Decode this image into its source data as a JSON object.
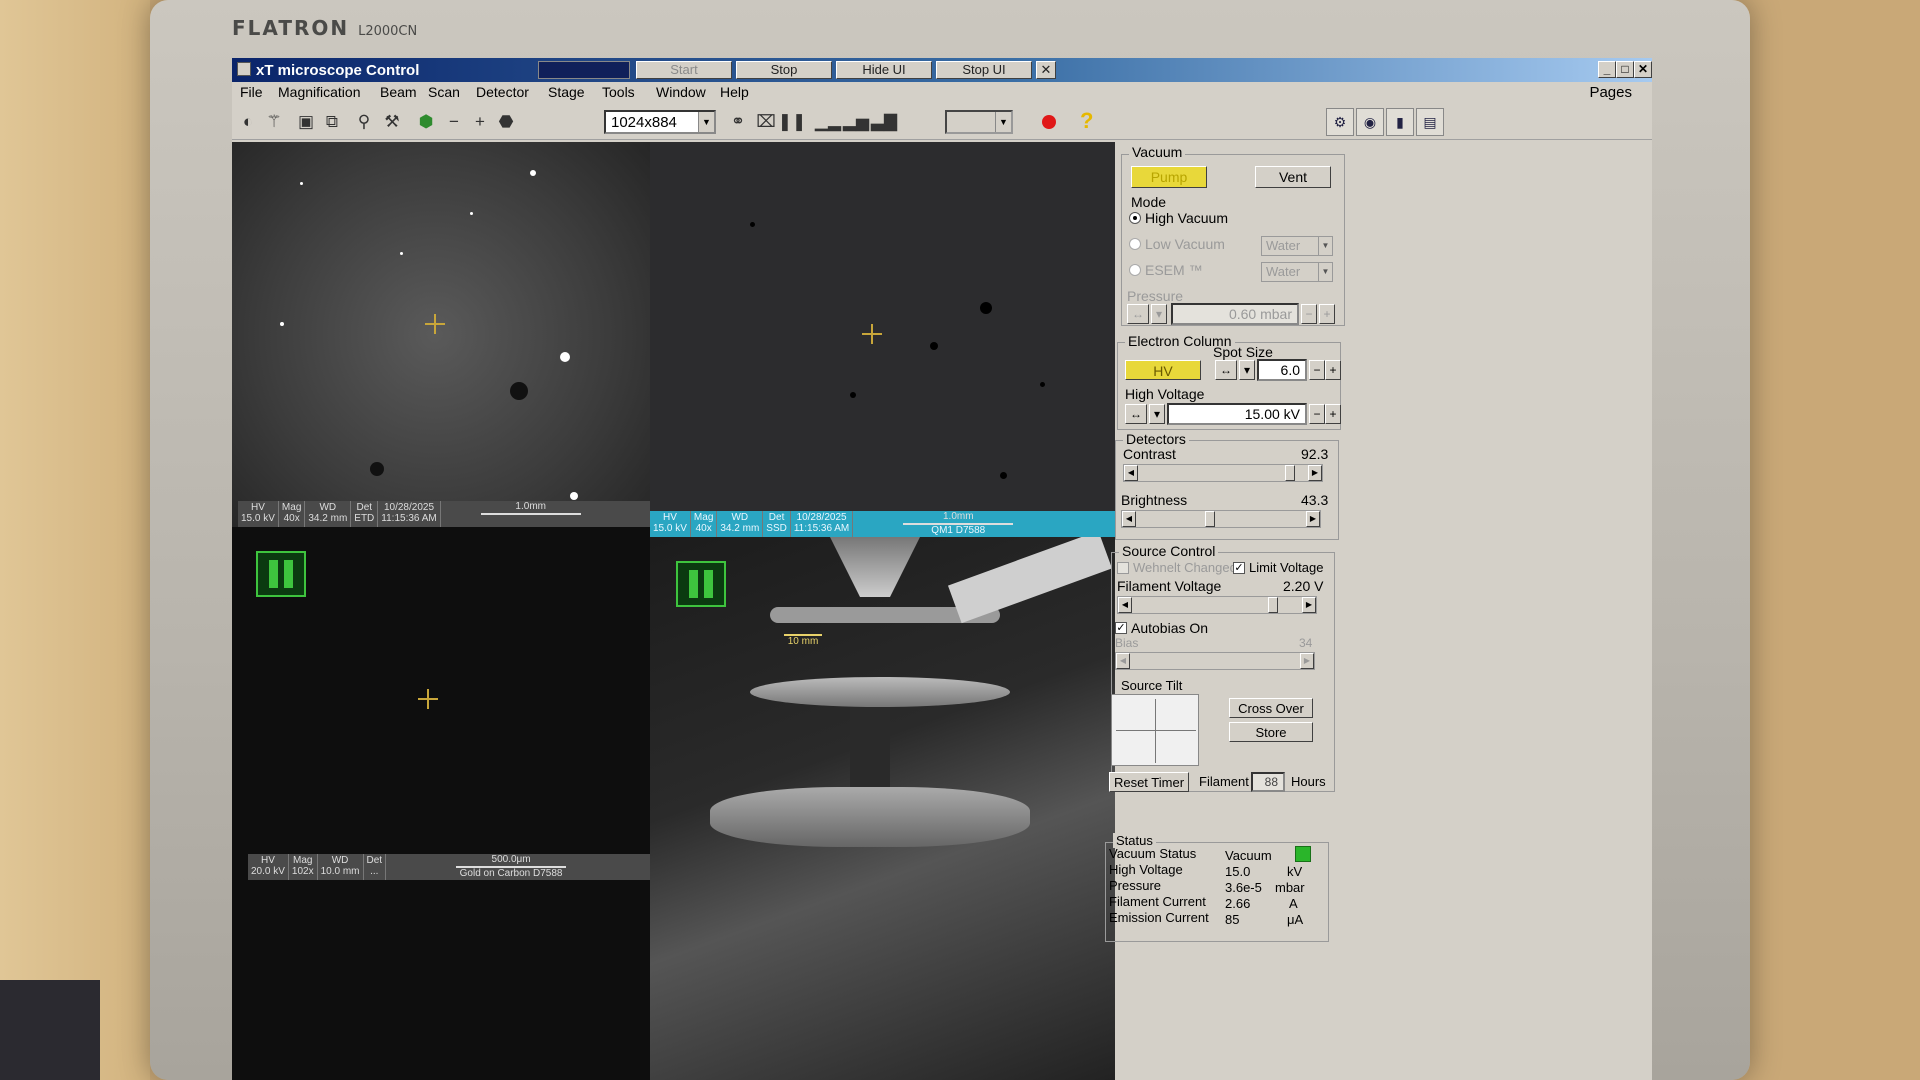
{
  "monitor": {
    "brand": "FLATRON",
    "model": "L2000CN"
  },
  "window": {
    "title": "xT microscope Control",
    "buttons": {
      "start": "Start",
      "stop": "Stop",
      "hide_ui": "Hide UI",
      "stop_ui": "Stop UI",
      "close": "✕"
    },
    "controls": {
      "minimize": "_",
      "maximize": "□",
      "close": "✕"
    }
  },
  "menu": {
    "items": [
      "File",
      "Magnification",
      "Beam",
      "Scan",
      "Detector",
      "Stage",
      "Tools",
      "Window",
      "Help"
    ],
    "pages": "Pages"
  },
  "toolbar": {
    "resolution": "1024x884",
    "icons": [
      "beam-icon",
      "detector-icon",
      "image-icon",
      "frame-icon",
      "focus-icon",
      "stage-icon",
      "turtle-slow-icon",
      "zoom-out-icon",
      "zoom-in-icon",
      "turtle-fast-icon",
      "link-icon",
      "camera-icon",
      "pause-icon",
      "histogram-1-icon",
      "histogram-2-icon",
      "histogram-3-icon",
      "record-icon",
      "help-icon"
    ],
    "help": "?"
  },
  "quads": {
    "q1": {
      "databar": [
        {
          "label": "HV",
          "value": "15.0 kV"
        },
        {
          "label": "Mag",
          "value": "40x"
        },
        {
          "label": "WD",
          "value": "34.2 mm"
        },
        {
          "label": "Det",
          "value": "ETD"
        },
        {
          "label": "10/28/2025",
          "value": "11:15:36 AM"
        }
      ],
      "scale": "1.0mm"
    },
    "q2": {
      "databar": [
        {
          "label": "HV",
          "value": "15.0 kV"
        },
        {
          "label": "Mag",
          "value": "40x"
        },
        {
          "label": "WD",
          "value": "34.2 mm"
        },
        {
          "label": "Det",
          "value": "SSD"
        },
        {
          "label": "10/28/2025",
          "value": "11:15:36 AM"
        }
      ],
      "scale": "1.0mm",
      "label": "QM1 D7588"
    },
    "q3": {
      "databar": [
        {
          "label": "HV",
          "value": "20.0 kV"
        },
        {
          "label": "Mag",
          "value": "102x"
        },
        {
          "label": "WD",
          "value": "10.0 mm"
        },
        {
          "label": "Det",
          "value": "..."
        }
      ],
      "scale": "500.0μm",
      "label": "Gold on Carbon D7588"
    },
    "q4": {
      "scale": "10 mm"
    }
  },
  "panel": {
    "vacuum": {
      "title": "Vacuum",
      "pump": "Pump",
      "vent": "Vent",
      "mode_title": "Mode",
      "high_vacuum": "High Vacuum",
      "low_vacuum": "Low Vacuum",
      "esem": "ESEM ™",
      "water1": "Water",
      "water2": "Water",
      "pressure_label": "Pressure",
      "pressure_value": "0.60",
      "pressure_unit": "mbar"
    },
    "electron_column": {
      "title": "Electron Column",
      "hv": "HV",
      "spot_label": "Spot Size",
      "spot_value": "6.0",
      "hv_label": "High Voltage",
      "hv_value": "15.00 kV"
    },
    "detectors": {
      "title": "Detectors",
      "contrast_label": "Contrast",
      "contrast_value": "92.3",
      "contrast_fraction": 0.92,
      "brightness_label": "Brightness",
      "brightness_value": "43.3",
      "brightness_fraction": 0.43
    },
    "source": {
      "title": "Source Control",
      "wehnelt": "Wehnelt Changed",
      "limit_voltage": "Limit Voltage",
      "filament_label": "Filament Voltage",
      "filament_value": "2.20 V",
      "filament_fraction": 0.85,
      "autobias": "Autobias On",
      "bias_label": "Bias",
      "bias_value": "34",
      "tilt_label": "Source Tilt",
      "cross_over": "Cross Over",
      "store": "Store",
      "reset_timer": "Reset Timer",
      "filament_timer_label": "Filament",
      "filament_hours": "88",
      "hours": "Hours"
    },
    "status": {
      "title": "Status",
      "rows": [
        {
          "name": "Vacuum Status",
          "value": "Vacuum",
          "unit": ""
        },
        {
          "name": "High Voltage",
          "value": "15.0",
          "unit": "kV"
        },
        {
          "name": "Pressure",
          "value": "3.6e-5",
          "unit": "mbar"
        },
        {
          "name": "Filament Current",
          "value": "2.66",
          "unit": "A"
        },
        {
          "name": "Emission Current",
          "value": "85",
          "unit": "μA"
        }
      ]
    },
    "side_icons": [
      "settings-page-icon",
      "globe-page-icon",
      "column-page-icon",
      "report-page-icon"
    ]
  }
}
